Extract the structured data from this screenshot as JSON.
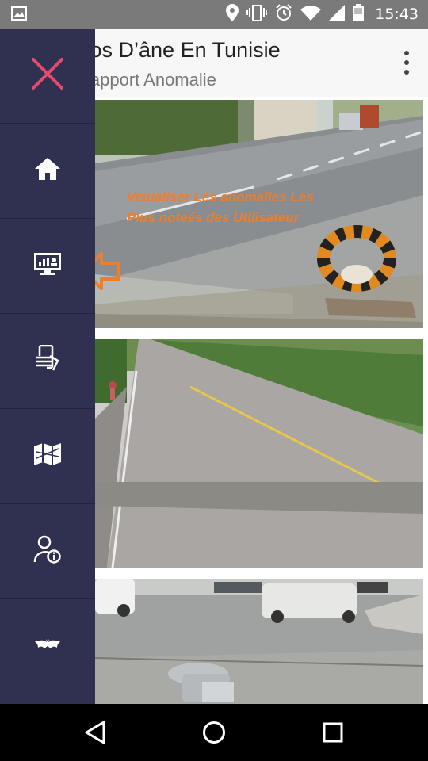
{
  "status_bar": {
    "time": "15:43",
    "icons": [
      "image-icon",
      "location-icon",
      "vibrate-icon",
      "alarm-icon",
      "wifi-icon",
      "signal-icon",
      "battery-icon"
    ]
  },
  "toolbar": {
    "title": "Dos D’âne En Tunisie",
    "subtitle": "Rapport Anomalie",
    "menu_icon": "more-vert-icon"
  },
  "drawer": {
    "background": "#303050",
    "items": [
      {
        "icon": "close-icon"
      },
      {
        "icon": "home-icon"
      },
      {
        "icon": "dashboard-monitor-icon"
      },
      {
        "icon": "phone-report-icon"
      },
      {
        "icon": "map-icon"
      },
      {
        "icon": "user-info-icon"
      },
      {
        "icon": "bat-icon"
      }
    ]
  },
  "annotation": {
    "text": "Visualiser Les anomalies Les Plus noteés des Utilisateur",
    "color": "#f07d2a"
  },
  "feed": {
    "cards": [
      {
        "name": "anomaly-photo-1"
      },
      {
        "name": "anomaly-photo-2"
      },
      {
        "name": "anomaly-photo-3"
      }
    ]
  },
  "nav_bar": {
    "icons": [
      "back-icon",
      "home-circle-icon",
      "recents-icon"
    ]
  }
}
